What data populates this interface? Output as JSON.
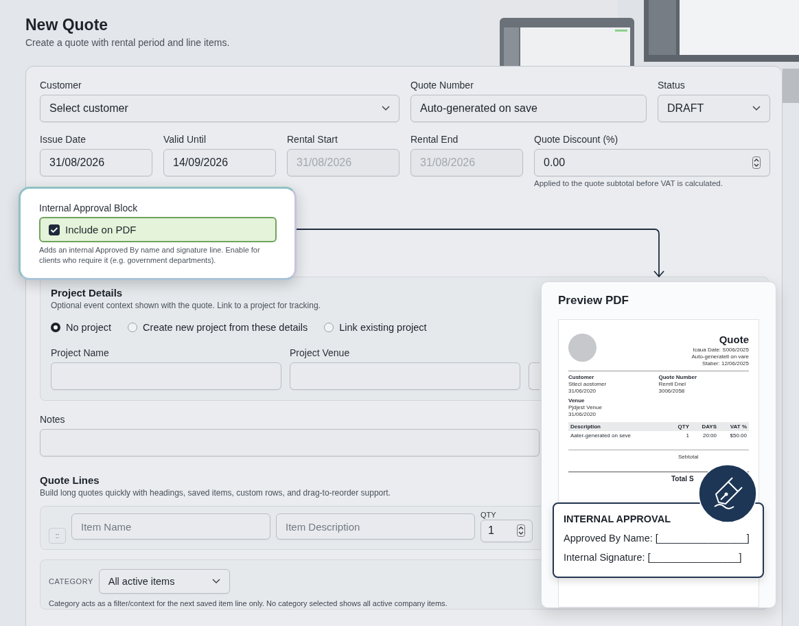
{
  "page": {
    "title": "New Quote",
    "subtitle": "Create a quote with rental period and line items."
  },
  "row1": [
    {
      "kind": "select",
      "label": "Customer",
      "value": "Select customer"
    },
    {
      "kind": "text",
      "label": "Quote Number",
      "value": "Auto-generated on save"
    },
    {
      "kind": "select",
      "label": "Status",
      "value": "DRAFT"
    }
  ],
  "row2": [
    {
      "kind": "date",
      "label": "Issue Date",
      "value": "31/08/2026",
      "disabled": false
    },
    {
      "kind": "date",
      "label": "Valid Until",
      "value": "14/09/2026",
      "disabled": false
    },
    {
      "kind": "date",
      "label": "Rental Start",
      "value": "31/08/2026",
      "disabled": true
    },
    {
      "kind": "date",
      "label": "Rental End",
      "value": "31/08/2026",
      "disabled": true
    },
    {
      "kind": "number",
      "label": "Quote Discount (%)",
      "value": "0.00",
      "disabled": false,
      "hint": "Applied to the quote subtotal before VAT is calculated."
    }
  ],
  "approval": {
    "label": "Internal Approval Block",
    "checkbox": {
      "label": "Include on PDF",
      "checked": true
    },
    "help": "Adds an internal Approved By name and signature line. Enable for clients who require it (e.g. government departments)."
  },
  "project": {
    "title": "Project Details",
    "subtitle": "Optional event context shown with the quote. Link to a project for tracking.",
    "options": [
      {
        "label": "No project",
        "selected": true
      },
      {
        "label": "Create new project from these details",
        "selected": false
      },
      {
        "label": "Link existing project",
        "selected": false
      }
    ],
    "fields": [
      {
        "label": "Project Name"
      },
      {
        "label": "Project Venue"
      }
    ]
  },
  "notes": {
    "label": "Notes"
  },
  "quote_lines": {
    "title": "Quote Lines",
    "subtitle": "Build long quotes quickly with headings, saved items, custom rows, and drag-to-reorder support.",
    "handle": "::",
    "item_name": {
      "placeholder": "Item Name"
    },
    "item_description": {
      "placeholder": "Item Description"
    },
    "qty": {
      "label": "QTY",
      "value": "1"
    },
    "category": {
      "label": "CATEGORY",
      "value": "All active items",
      "help": "Category acts as a filter/context for the next saved item line only. No category selected shows all active company items."
    }
  },
  "preview": {
    "title": "Preview PDF",
    "document": {
      "title": "Quote",
      "meta": [
        "Icaua Date: S006/2025",
        "Auto-generatetl on vare",
        "Staber: 12/06/2025"
      ],
      "blocks": [
        {
          "heading": "Customer",
          "lines": [
            "Stleci aostomer",
            "31/06/2020"
          ]
        },
        {
          "heading": "Quote Number",
          "lines": [
            "Remtl Dnel",
            "3006/2058"
          ]
        },
        {
          "heading": "Venue",
          "lines": [
            "Pjdjest Venue",
            "31/06/2020"
          ]
        }
      ],
      "columns": [
        "Description",
        "QTY",
        "DAYS",
        "VAT %"
      ],
      "rows": [
        [
          "Aater-generated on seve",
          "1",
          "20:00",
          "$50.00"
        ]
      ],
      "subtotal_label": "Sebtotal",
      "total_label": "Total S"
    },
    "approval": {
      "title": "INTERNAL APPROVAL",
      "lines": [
        "Approved By Name: [________________]",
        "Internal Signature: [________________]"
      ]
    }
  }
}
